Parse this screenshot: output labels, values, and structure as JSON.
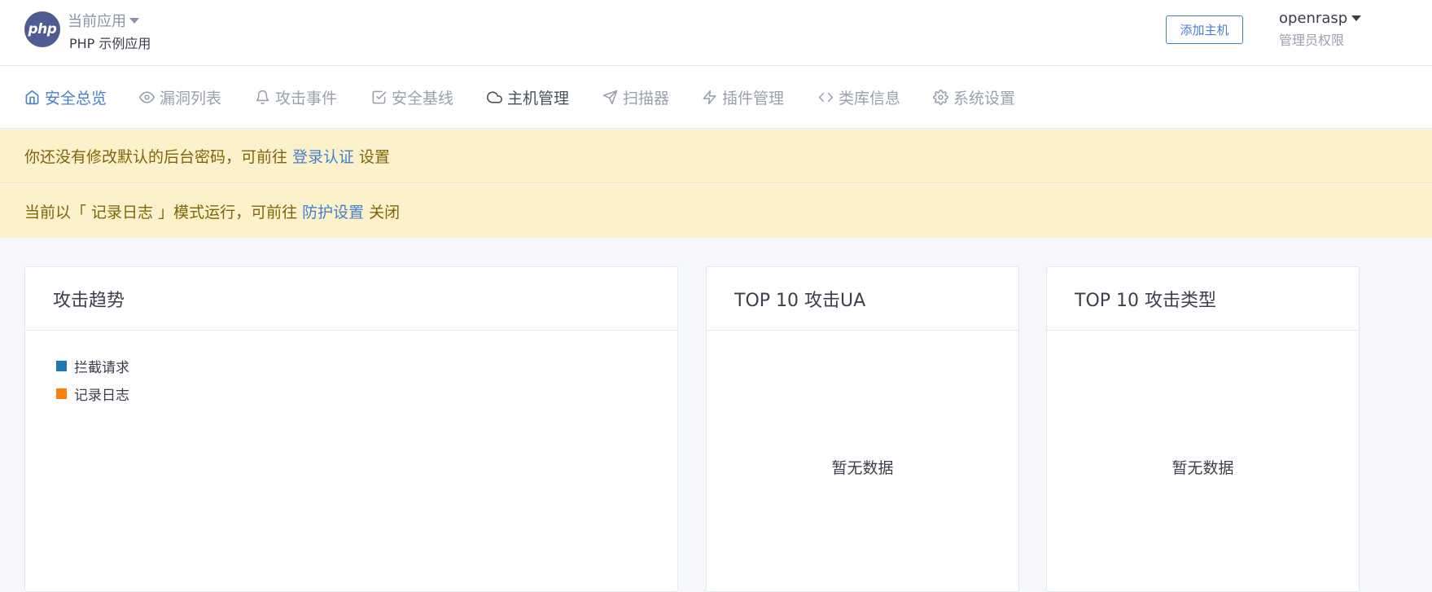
{
  "header": {
    "logo_text": "php",
    "app_label": "当前应用",
    "app_name": "PHP 示例应用",
    "add_host_label": "添加主机",
    "user_name": "openrasp",
    "user_role": "管理员权限"
  },
  "nav": {
    "items": [
      {
        "label": "安全总览",
        "icon": "home-icon"
      },
      {
        "label": "漏洞列表",
        "icon": "eye-icon"
      },
      {
        "label": "攻击事件",
        "icon": "bell-icon"
      },
      {
        "label": "安全基线",
        "icon": "check-square-icon"
      },
      {
        "label": "主机管理",
        "icon": "cloud-icon"
      },
      {
        "label": "扫描器",
        "icon": "send-icon"
      },
      {
        "label": "插件管理",
        "icon": "zap-icon"
      },
      {
        "label": "类库信息",
        "icon": "code-icon"
      },
      {
        "label": "系统设置",
        "icon": "gear-icon"
      }
    ]
  },
  "alerts": {
    "password": {
      "before": "你还没有修改默认的后台密码，可前往",
      "link": "登录认证",
      "after": "设置"
    },
    "mode": {
      "before": "当前以「 记录日志 」模式运行，可前往",
      "link": "防护设置",
      "after": "关闭"
    }
  },
  "cards": {
    "trend": {
      "title": "攻击趋势",
      "legend": [
        {
          "label": "拦截请求",
          "color": "#1f77b4"
        },
        {
          "label": "记录日志",
          "color": "#ff7f0e"
        }
      ]
    },
    "top_ua": {
      "title": "TOP 10 攻击UA",
      "empty": "暂无数据"
    },
    "top_type": {
      "title": "TOP 10 攻击类型",
      "empty": "暂无数据"
    }
  }
}
